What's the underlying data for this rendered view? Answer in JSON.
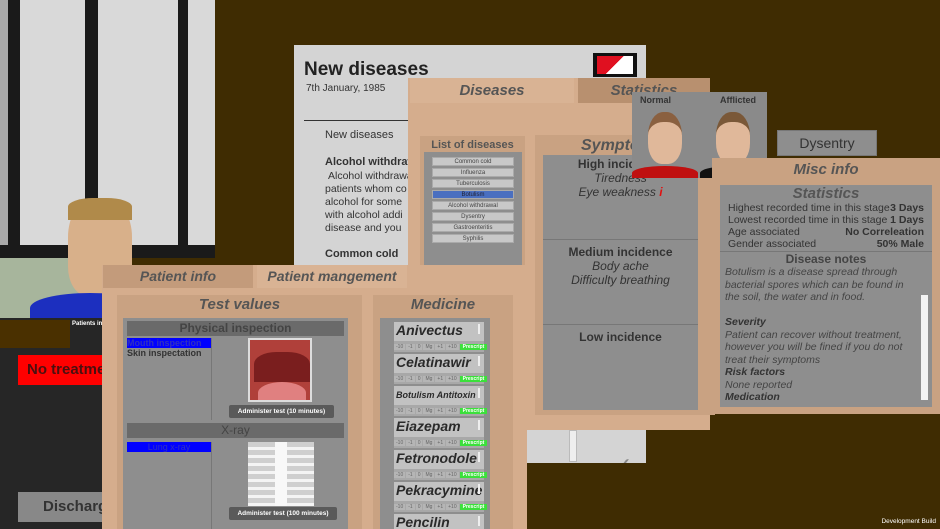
{
  "background": {
    "room_color": "#3f2c02"
  },
  "left": {
    "patients_label": "Patients in",
    "no_treatment": "No treatment",
    "discharge": "Discharge"
  },
  "newspaper": {
    "title": "New diseases",
    "date": "7th January, 1985",
    "section": "New diseases",
    "h1": "Alcohol withdrawal",
    "lines": [
      "Alcohol withdrawal",
      "patients whom co",
      "alcohol for some",
      "with alcohol addi",
      "disease and you"
    ],
    "h2": "Common cold"
  },
  "diseases": {
    "tab_diseases": "Diseases",
    "tab_statistics": "Statistics",
    "list_title": "List of diseases",
    "items": [
      "Common cold",
      "Influenza",
      "Tuberculosis",
      "Botulism",
      "Alcohol withdrawal",
      "Dysentry",
      "Gastroenteritis",
      "Syphilis"
    ],
    "selected": "Botulism"
  },
  "symptoms": {
    "title": "Symptoms",
    "high": "High incidence",
    "high_items": [
      "Tiredness",
      "Eye weakness"
    ],
    "medium": "Medium incidence",
    "medium_items": [
      "Body ache",
      "Difficulty breathing"
    ],
    "low": "Low incidence"
  },
  "faces": {
    "normal": "Normal",
    "afflicted": "Afflicted"
  },
  "dysentry_button": "Dysentry",
  "misc": {
    "title": "Misc info",
    "stats_title": "Statistics",
    "stats": [
      {
        "label": "Highest recorded time in this stage",
        "value": "3 Days"
      },
      {
        "label": "Lowest recorded time in this stage",
        "value": "1 Days"
      },
      {
        "label": "Age associated",
        "value": "No Correleation"
      },
      {
        "label": "Gender associated",
        "value": "50% Male"
      }
    ],
    "notes_title": "Disease notes",
    "notes_intro": "Botulism is a disease spread through bacterial spores which can be found in the soil, the water and in food.",
    "severity_h": "Severity",
    "severity": "Patient can recover without treatment, however you will be fined if you do not treat their symptoms",
    "risk_h": "Risk factors",
    "risk": "None reported",
    "medication_h": "Medication"
  },
  "patient": {
    "tab_info": "Patient info",
    "tab_management": "Patient mangement",
    "test_values": "Test values",
    "physical": "Physical inspection",
    "phys_items": [
      "Mouth inspection",
      "Skin inspectation"
    ],
    "phys_button": "Administer test (10 minutes)",
    "xray": "X-ray",
    "xray_items": [
      "Lung x-ray"
    ],
    "xray_button": "Administer test (100 minutes)"
  },
  "medicine": {
    "title": "Medicine",
    "items": [
      "Anivectus",
      "Celatinawir",
      "Botulism Antitoxin",
      "Eiazepam",
      "Fetronodole",
      "Pekracymine",
      "Pencilin"
    ],
    "controls": [
      "-10",
      "-1",
      "0",
      "Mg",
      "+1",
      "+10"
    ],
    "prescript": "Prescript"
  },
  "build": "Development Build"
}
